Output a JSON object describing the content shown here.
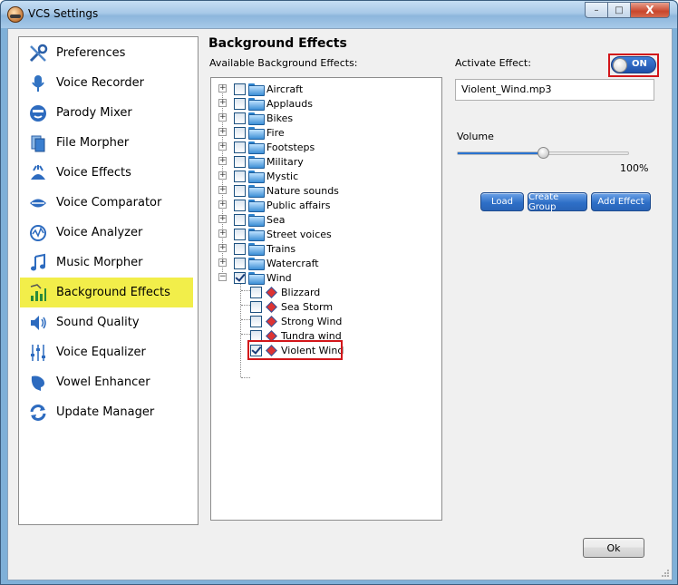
{
  "window": {
    "title": "VCS Settings",
    "buttons": {
      "minimize": "–",
      "maximize": "□",
      "close": "X"
    }
  },
  "sidebar": {
    "items": [
      {
        "label": "Preferences",
        "icon": "wrench-screwdriver-icon"
      },
      {
        "label": "Voice Recorder",
        "icon": "microphone-icon"
      },
      {
        "label": "Parody Mixer",
        "icon": "mask-icon"
      },
      {
        "label": "File Morpher",
        "icon": "file-morph-icon"
      },
      {
        "label": "Voice Effects",
        "icon": "voice-effects-icon"
      },
      {
        "label": "Voice Comparator",
        "icon": "lips-icon"
      },
      {
        "label": "Voice Analyzer",
        "icon": "analyzer-icon"
      },
      {
        "label": "Music Morpher",
        "icon": "music-note-icon"
      },
      {
        "label": "Background Effects",
        "icon": "background-effects-icon",
        "selected": true
      },
      {
        "label": "Sound Quality",
        "icon": "speaker-icon"
      },
      {
        "label": "Voice Equalizer",
        "icon": "equalizer-icon"
      },
      {
        "label": "Vowel Enhancer",
        "icon": "vowel-icon"
      },
      {
        "label": "Update Manager",
        "icon": "update-arrows-icon"
      }
    ],
    "selected_color": "#f2ee4a"
  },
  "main": {
    "title": "Background Effects",
    "available_label": "Available Background Effects:",
    "tree": {
      "folders": [
        {
          "label": "Aircraft",
          "checked": false
        },
        {
          "label": "Applauds",
          "checked": false
        },
        {
          "label": "Bikes",
          "checked": false
        },
        {
          "label": "Fire",
          "checked": false
        },
        {
          "label": "Footsteps",
          "checked": false
        },
        {
          "label": "Military",
          "checked": false
        },
        {
          "label": "Mystic",
          "checked": false
        },
        {
          "label": "Nature sounds",
          "checked": false
        },
        {
          "label": "Public affairs",
          "checked": false
        },
        {
          "label": "Sea",
          "checked": false
        },
        {
          "label": "Street voices",
          "checked": false
        },
        {
          "label": "Trains",
          "checked": false
        },
        {
          "label": "Watercraft",
          "checked": false
        },
        {
          "label": "Wind",
          "checked": true,
          "expanded": true
        }
      ],
      "wind_children": [
        {
          "label": "Blizzard",
          "checked": false
        },
        {
          "label": "Sea Storm",
          "checked": false
        },
        {
          "label": "Strong Wind",
          "checked": false
        },
        {
          "label": "Tundra wind",
          "checked": false
        },
        {
          "label": "Violent Wind",
          "checked": true,
          "highlighted": true
        }
      ]
    }
  },
  "right_panel": {
    "activate_label": "Activate Effect:",
    "toggle": {
      "state": "ON"
    },
    "file_field": {
      "value": "Violent_Wind.mp3"
    },
    "volume": {
      "label": "Volume",
      "value_text": "100%",
      "slider_fraction": 0.5
    },
    "buttons": {
      "load": "Load",
      "create_group": "Create Group",
      "add_effect": "Add Effect"
    }
  },
  "footer": {
    "ok_label": "Ok"
  },
  "colors": {
    "highlight_red": "#d2161a",
    "accent_blue": "#2e6fc7"
  }
}
